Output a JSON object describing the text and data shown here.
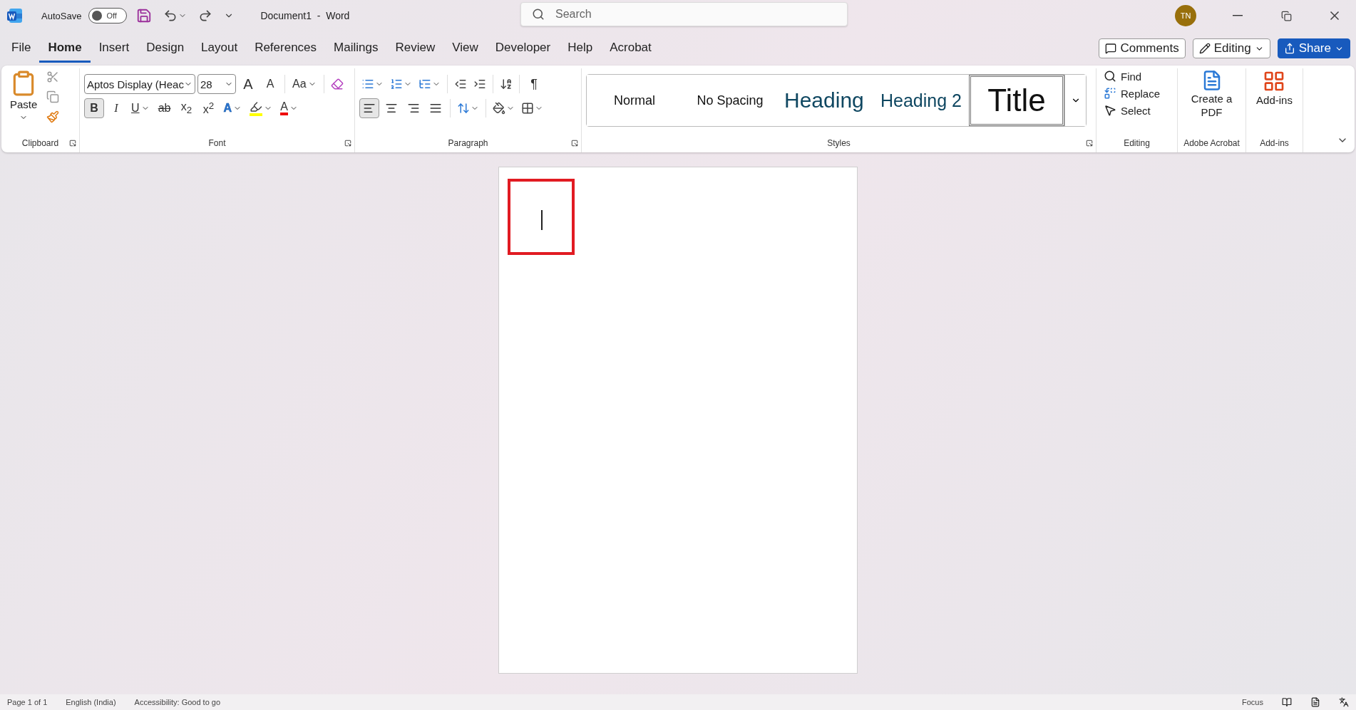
{
  "app": {
    "autosave_label": "AutoSave",
    "autosave": {
      "on": false,
      "label": "Off"
    },
    "document_title": "Document1  -  Word",
    "search": {
      "placeholder": "Search"
    },
    "avatar": "TN"
  },
  "tabs": [
    {
      "label": "File",
      "selected": false
    },
    {
      "label": "Home",
      "selected": true
    },
    {
      "label": "Insert",
      "selected": false
    },
    {
      "label": "Design",
      "selected": false
    },
    {
      "label": "Layout",
      "selected": false
    },
    {
      "label": "References",
      "selected": false
    },
    {
      "label": "Mailings",
      "selected": false
    },
    {
      "label": "Review",
      "selected": false
    },
    {
      "label": "View",
      "selected": false
    },
    {
      "label": "Developer",
      "selected": false
    },
    {
      "label": "Help",
      "selected": false
    },
    {
      "label": "Acrobat",
      "selected": false
    }
  ],
  "actions": {
    "comments": "Comments",
    "editing": "Editing",
    "share": "Share"
  },
  "clipboard": {
    "paste": "Paste",
    "label": "Clipboard"
  },
  "font": {
    "name": "Aptos Display (Heac",
    "size": "28",
    "label": "Font",
    "grow": "A",
    "shrink": "A",
    "case": "Aa",
    "buttons": [
      {
        "label": "B",
        "kind": "bold",
        "selected": true
      },
      {
        "label": "I",
        "kind": "italic",
        "selected": false
      },
      {
        "label": "U",
        "kind": "underline",
        "selected": false
      },
      {
        "label": "ab",
        "kind": "strike",
        "selected": false
      },
      {
        "label": "x$_{2}$",
        "kind": "subscript",
        "selected": false
      },
      {
        "label": "x$^{2}$",
        "kind": "superscript",
        "selected": false
      },
      {
        "label": "A",
        "kind": "effects",
        "selected": false
      },
      {
        "kind": "highlight",
        "selected": false
      },
      {
        "label": "A",
        "kind": "color",
        "selected": false
      }
    ]
  },
  "paragraph": {
    "label": "Paragraph",
    "marks": "¶",
    "align": [
      {
        "kind": "left",
        "selected": true
      },
      {
        "kind": "center",
        "selected": false
      },
      {
        "kind": "right",
        "selected": false
      },
      {
        "kind": "justify",
        "selected": false
      }
    ]
  },
  "styles": {
    "label": "Styles",
    "items": [
      {
        "label": "Normal",
        "kind": "normal",
        "selected": false
      },
      {
        "label": "No Spacing",
        "kind": "normal",
        "selected": false
      },
      {
        "label": "Heading",
        "kind": "heading1",
        "selected": false
      },
      {
        "label": "Heading 2",
        "kind": "heading2",
        "selected": false
      },
      {
        "label": "Title",
        "kind": "title",
        "selected": true
      }
    ]
  },
  "editing": {
    "label": "Editing",
    "items": [
      {
        "label": "Find",
        "kind": "find"
      },
      {
        "label": "Replace",
        "kind": "replace"
      },
      {
        "label": "Select",
        "kind": "select"
      }
    ]
  },
  "acrobat": {
    "button": "Create a PDF",
    "label": "Adobe Acrobat"
  },
  "addins": {
    "button": "Add-ins",
    "label": "Add-ins"
  },
  "status_bar": {
    "left": [
      "Page 1 of 1",
      "English (India)",
      "Accessibility: Good to go"
    ],
    "right": [
      "Focus"
    ]
  }
}
